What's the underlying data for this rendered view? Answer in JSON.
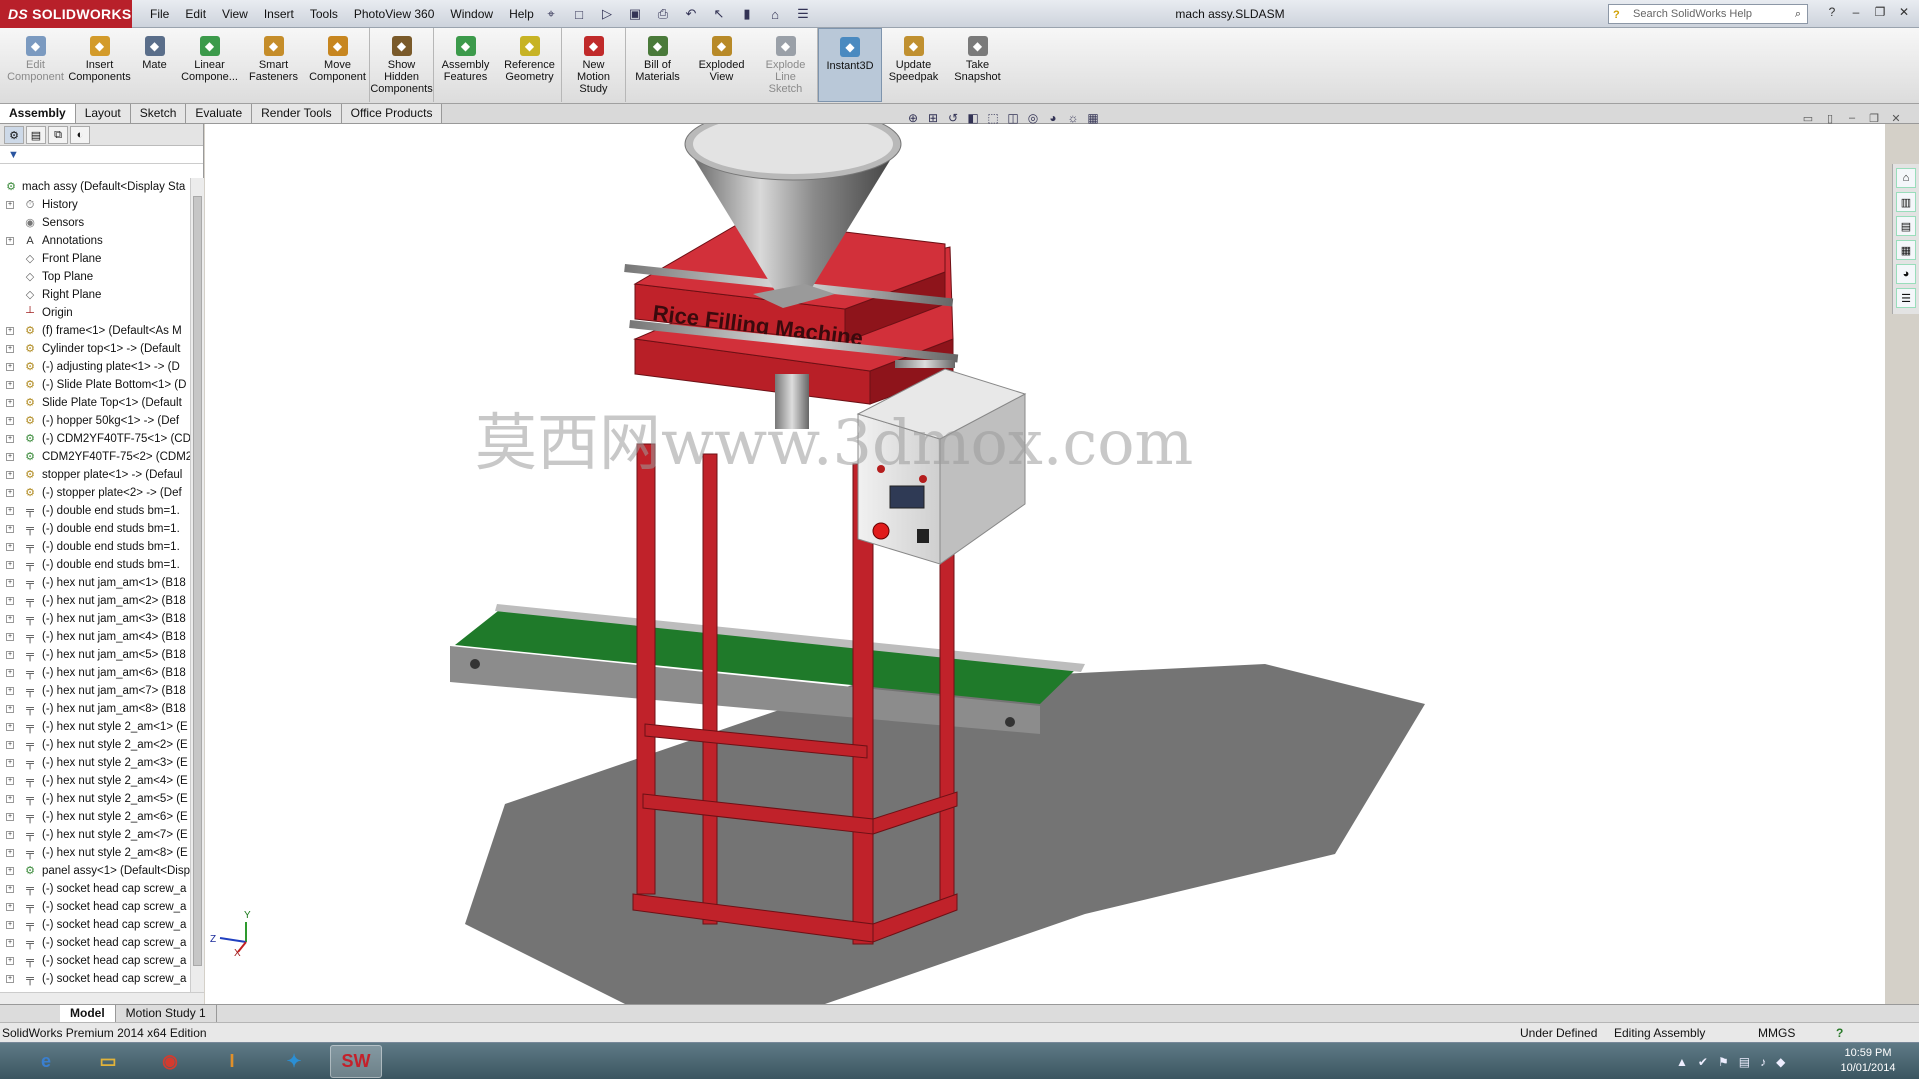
{
  "app": {
    "brand": "SOLIDWORKS",
    "brand_prefix": "DS",
    "document_title": "mach assy.SLDASM",
    "search_placeholder": "Search SolidWorks Help"
  },
  "menu": [
    "File",
    "Edit",
    "View",
    "Insert",
    "Tools",
    "PhotoView 360",
    "Window",
    "Help"
  ],
  "command_manager": [
    {
      "label": "Edit Component",
      "icon": "edit-component-icon",
      "disabled": true
    },
    {
      "label": "Insert Components",
      "icon": "insert-components-icon"
    },
    {
      "label": "Mate",
      "icon": "mate-icon"
    },
    {
      "label": "Linear Compone...",
      "icon": "linear-pattern-icon"
    },
    {
      "label": "Smart Fasteners",
      "icon": "smart-fasteners-icon"
    },
    {
      "label": "Move Component",
      "icon": "move-component-icon"
    },
    {
      "label": "Show Hidden Components",
      "icon": "show-hidden-icon"
    },
    {
      "label": "Assembly Features",
      "icon": "assembly-features-icon"
    },
    {
      "label": "Reference Geometry",
      "icon": "reference-geometry-icon"
    },
    {
      "label": "New Motion Study",
      "icon": "motion-study-icon"
    },
    {
      "label": "Bill of Materials",
      "icon": "bom-icon"
    },
    {
      "label": "Exploded View",
      "icon": "exploded-view-icon"
    },
    {
      "label": "Explode Line Sketch",
      "icon": "explode-line-icon",
      "disabled": true
    },
    {
      "label": "Instant3D",
      "icon": "instant3d-icon",
      "active": true
    },
    {
      "label": "Update Speedpak",
      "icon": "speedpak-icon"
    },
    {
      "label": "Take Snapshot",
      "icon": "snapshot-icon"
    }
  ],
  "cm_tabs": [
    "Assembly",
    "Layout",
    "Sketch",
    "Evaluate",
    "Render Tools",
    "Office Products"
  ],
  "tree": {
    "root": "mach assy  (Default<Display Sta",
    "items": [
      {
        "label": "History",
        "icon": "history-icon"
      },
      {
        "label": "Sensors",
        "icon": "sensors-icon"
      },
      {
        "label": "Annotations",
        "icon": "annotations-icon"
      },
      {
        "label": "Front Plane",
        "icon": "plane-icon"
      },
      {
        "label": "Top Plane",
        "icon": "plane-icon"
      },
      {
        "label": "Right Plane",
        "icon": "plane-icon"
      },
      {
        "label": "Origin",
        "icon": "origin-icon"
      },
      {
        "label": "(f) frame<1> (Default<As M",
        "icon": "part-icon"
      },
      {
        "label": "Cylinder top<1> -> (Default",
        "icon": "part-icon"
      },
      {
        "label": "(-) adjusting plate<1> -> (D",
        "icon": "part-icon"
      },
      {
        "label": "(-) Slide Plate Bottom<1> (D",
        "icon": "part-icon"
      },
      {
        "label": "Slide Plate Top<1> (Default",
        "icon": "part-icon"
      },
      {
        "label": "(-) hopper 50kg<1> -> (Def",
        "icon": "part-icon"
      },
      {
        "label": "(-) CDM2YF40TF-75<1> (CD",
        "icon": "subassembly-icon"
      },
      {
        "label": "CDM2YF40TF-75<2> (CDM2",
        "icon": "subassembly-icon"
      },
      {
        "label": "stopper plate<1> -> (Defaul",
        "icon": "part-icon"
      },
      {
        "label": "(-) stopper plate<2> -> (Def",
        "icon": "part-icon"
      },
      {
        "label": "(-) double end studs bm=1.",
        "icon": "fastener-icon"
      },
      {
        "label": "(-) double end studs bm=1.",
        "icon": "fastener-icon"
      },
      {
        "label": "(-) double end studs bm=1.",
        "icon": "fastener-icon"
      },
      {
        "label": "(-) double end studs bm=1.",
        "icon": "fastener-icon"
      },
      {
        "label": "(-) hex nut jam_am<1> (B18",
        "icon": "fastener-icon"
      },
      {
        "label": "(-) hex nut jam_am<2> (B18",
        "icon": "fastener-icon"
      },
      {
        "label": "(-) hex nut jam_am<3> (B18",
        "icon": "fastener-icon"
      },
      {
        "label": "(-) hex nut jam_am<4> (B18",
        "icon": "fastener-icon"
      },
      {
        "label": "(-) hex nut jam_am<5> (B18",
        "icon": "fastener-icon"
      },
      {
        "label": "(-) hex nut jam_am<6> (B18",
        "icon": "fastener-icon"
      },
      {
        "label": "(-) hex nut jam_am<7> (B18",
        "icon": "fastener-icon"
      },
      {
        "label": "(-) hex nut jam_am<8> (B18",
        "icon": "fastener-icon"
      },
      {
        "label": "(-) hex nut style 2_am<1> (E",
        "icon": "fastener-icon"
      },
      {
        "label": "(-) hex nut style 2_am<2> (E",
        "icon": "fastener-icon"
      },
      {
        "label": "(-) hex nut style 2_am<3> (E",
        "icon": "fastener-icon"
      },
      {
        "label": "(-) hex nut style 2_am<4> (E",
        "icon": "fastener-icon"
      },
      {
        "label": "(-) hex nut style 2_am<5> (E",
        "icon": "fastener-icon"
      },
      {
        "label": "(-) hex nut style 2_am<6> (E",
        "icon": "fastener-icon"
      },
      {
        "label": "(-) hex nut style 2_am<7> (E",
        "icon": "fastener-icon"
      },
      {
        "label": "(-) hex nut style 2_am<8> (E",
        "icon": "fastener-icon"
      },
      {
        "label": "panel assy<1> (Default<Disp",
        "icon": "subassembly-icon"
      },
      {
        "label": "(-) socket head cap screw_a",
        "icon": "fastener-icon"
      },
      {
        "label": "(-) socket head cap screw_a",
        "icon": "fastener-icon"
      },
      {
        "label": "(-) socket head cap screw_a",
        "icon": "fastener-icon"
      },
      {
        "label": "(-) socket head cap screw_a",
        "icon": "fastener-icon"
      },
      {
        "label": "(-) socket head cap screw_a",
        "icon": "fastener-icon"
      },
      {
        "label": "(-) socket head cap screw_a",
        "icon": "fastener-icon"
      }
    ]
  },
  "model": {
    "machine_label": "Rice Filling Machine",
    "watermark": "莫西网www.3dmox.com",
    "triad_axes": {
      "x": "X",
      "y": "Y",
      "z": "Z"
    }
  },
  "bottom_tabs": [
    "Model",
    "Motion Study 1"
  ],
  "status": {
    "edition": "SolidWorks Premium 2014 x64 Edition",
    "definition": "Under Defined",
    "mode": "Editing Assembly",
    "units": "MMGS",
    "help": "?"
  },
  "taskbar": {
    "apps": [
      {
        "name": "internet-explorer",
        "glyph": "e"
      },
      {
        "name": "file-explorer",
        "glyph": "▭"
      },
      {
        "name": "chrome",
        "glyph": "◉"
      },
      {
        "name": "inventor",
        "glyph": "I"
      },
      {
        "name": "media",
        "glyph": "✦"
      },
      {
        "name": "solidworks",
        "glyph": "SW"
      }
    ],
    "time": "10:59 PM",
    "date": "10/01/2014"
  },
  "colors": {
    "frame_red": "#c0222a",
    "conveyor_green": "#1f7a2a",
    "brand_red": "#b8202a"
  }
}
